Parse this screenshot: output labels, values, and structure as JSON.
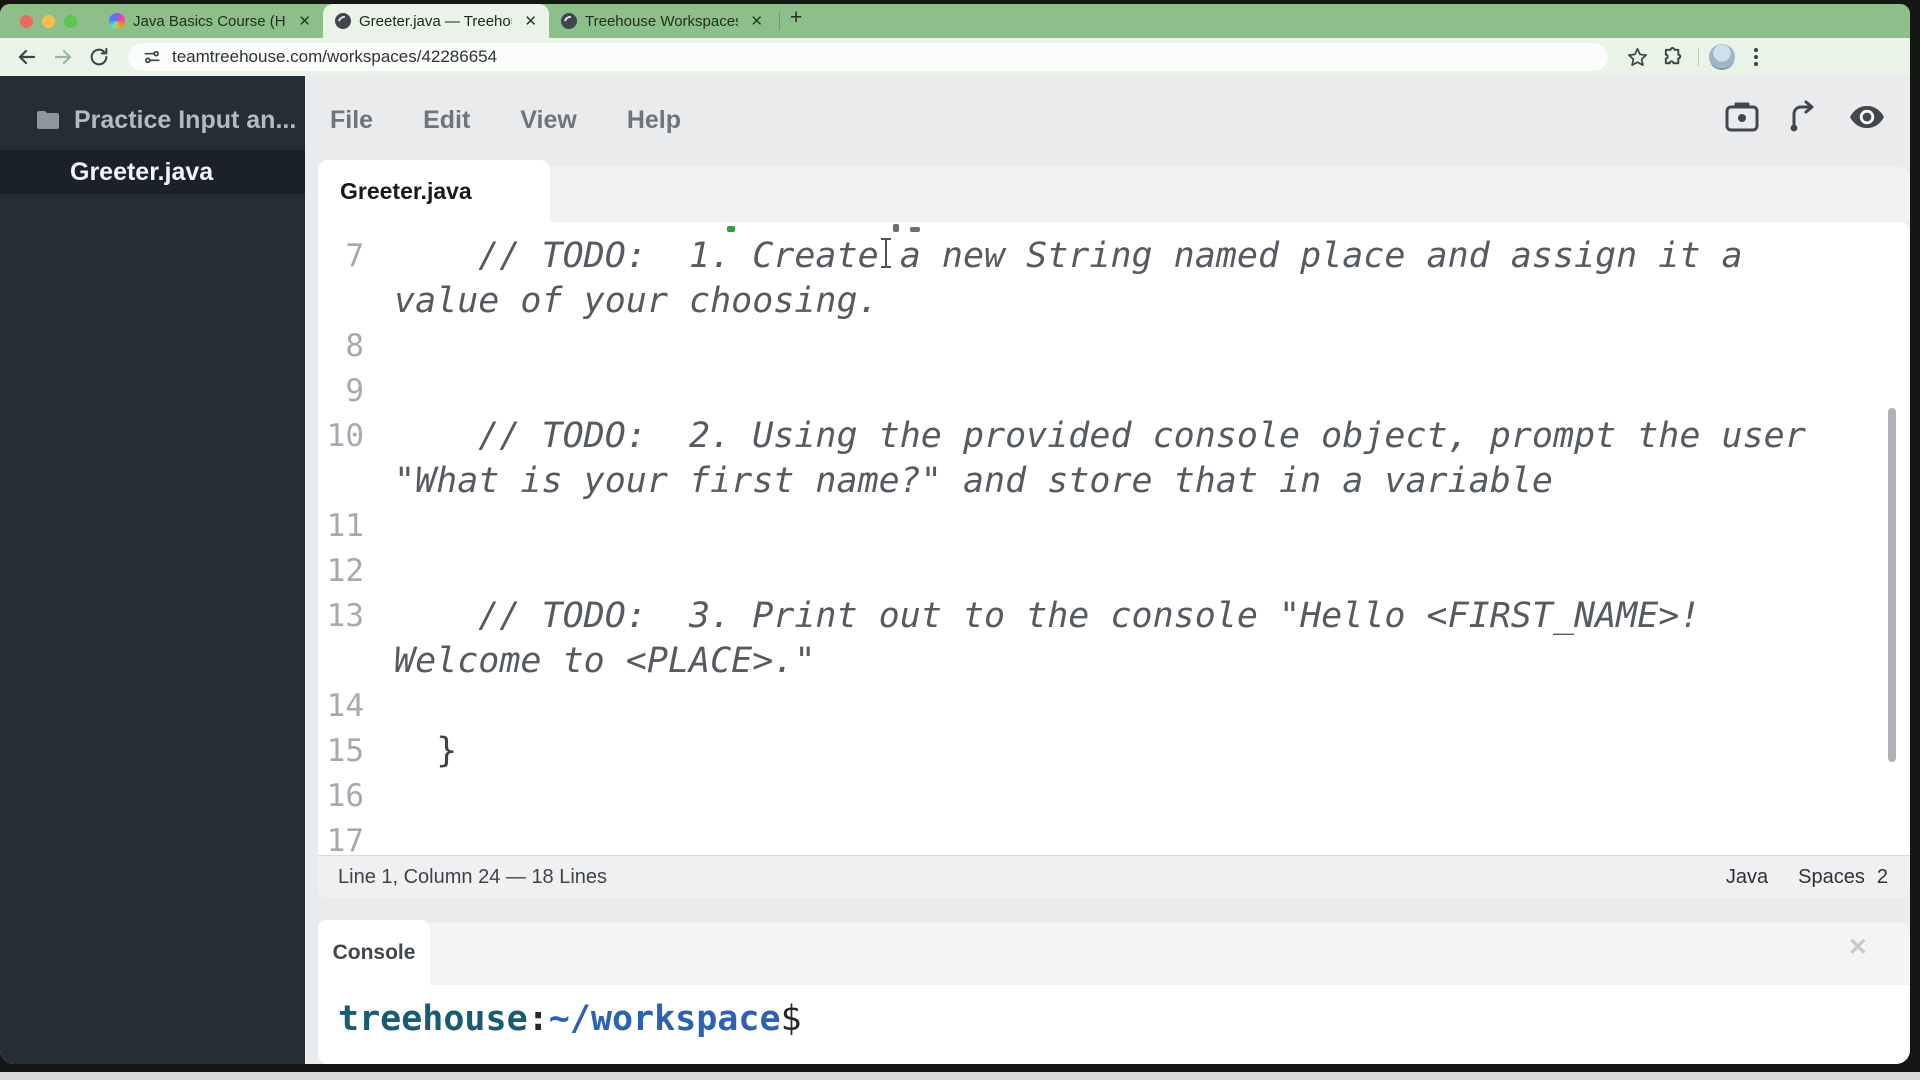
{
  "browser": {
    "tabs": [
      {
        "title": "Java Basics Course (How To)"
      },
      {
        "title": "Greeter.java — Treehouse Wo"
      },
      {
        "title": "Treehouse Workspaces"
      }
    ],
    "close_label": "✕",
    "new_tab_label": "+",
    "url": "teamtreehouse.com/workspaces/42286654"
  },
  "sidebar": {
    "folder_label": "Practice Input an...",
    "file_label": "Greeter.java"
  },
  "menubar": {
    "items": [
      "File",
      "Edit",
      "View",
      "Help"
    ]
  },
  "editor": {
    "tab_label": "Greeter.java",
    "rows": [
      {
        "num": "",
        "text": "",
        "type": "fragment"
      },
      {
        "num": "7",
        "text": "    // TODO:  1. Create a new String named place and assign it a",
        "type": "comment"
      },
      {
        "num": "",
        "text": "value of your choosing.",
        "type": "comment"
      },
      {
        "num": "8",
        "text": "",
        "type": "comment"
      },
      {
        "num": "9",
        "text": "",
        "type": "comment"
      },
      {
        "num": "10",
        "text": "    // TODO:  2. Using the provided console object, prompt the user",
        "type": "comment"
      },
      {
        "num": "",
        "text": "\"What is your first name?\" and store that in a variable",
        "type": "comment"
      },
      {
        "num": "11",
        "text": "",
        "type": "comment"
      },
      {
        "num": "12",
        "text": "",
        "type": "comment"
      },
      {
        "num": "13",
        "text": "    // TODO:  3. Print out to the console \"Hello <FIRST_NAME>!",
        "type": "comment"
      },
      {
        "num": "",
        "text": "Welcome to <PLACE>.\"",
        "type": "comment"
      },
      {
        "num": "14",
        "text": "",
        "type": "comment"
      },
      {
        "num": "15",
        "text": "  }",
        "type": "code"
      },
      {
        "num": "16",
        "text": "",
        "type": "comment"
      },
      {
        "num": "17",
        "text": "",
        "type": "comment"
      }
    ],
    "status_left": "Line 1, Column 24 — 18 Lines",
    "status_language": "Java",
    "status_spaces_label": "Spaces",
    "status_spaces_value": "2"
  },
  "console": {
    "tab_label": "Console",
    "close_label": "✕",
    "prompt_user": "treehouse",
    "prompt_colon": ":",
    "prompt_path": "~/workspace",
    "prompt_dollar": "$"
  },
  "colors": {
    "tabbar_green": "#8dbf8b",
    "toolbar_green": "#e9f3e8",
    "sidebar_dark": "#262d36",
    "prompt_user": "#185c74",
    "prompt_path": "#2c61b4"
  }
}
